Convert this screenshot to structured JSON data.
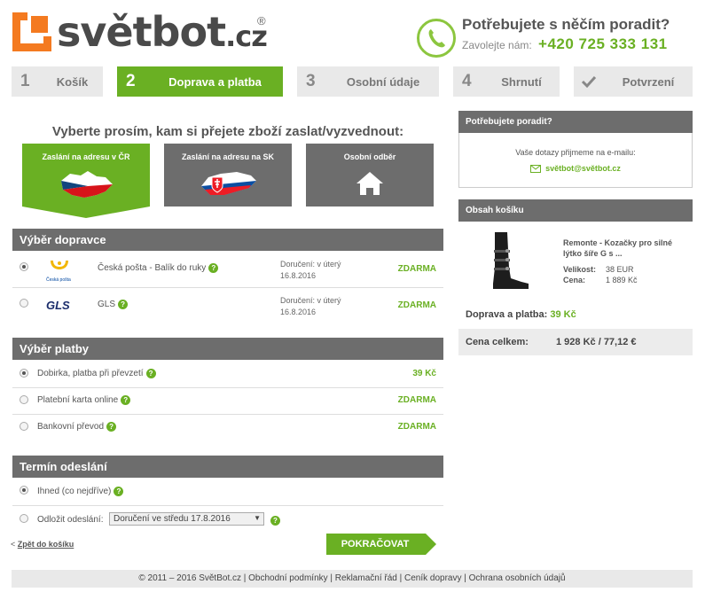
{
  "header": {
    "logo_main": "světbot",
    "logo_tld": ".cz",
    "logo_reg": "®",
    "help_title": "Potřebujete s něčím poradit?",
    "call_label": "Zavolejte nám:",
    "phone": "+420 725 333 131",
    "accent_color": "#6ab023",
    "logo_color": "#f47a20"
  },
  "steps": [
    {
      "num": "1",
      "label": "Košík"
    },
    {
      "num": "2",
      "label": "Doprava a platba"
    },
    {
      "num": "3",
      "label": "Osobní údaje"
    },
    {
      "num": "4",
      "label": "Shrnutí"
    },
    {
      "num": "check-icon",
      "label": "Potvrzení"
    }
  ],
  "destination": {
    "question": "Vyberte prosím, kam si přejete zboží zaslat/vyzvednout:",
    "options": [
      "Zaslání na adresu v ČR",
      "Zaslání na adresu na SK",
      "Osobní odběr"
    ]
  },
  "carriers": {
    "title": "Výběr dopravce",
    "items": [
      {
        "name": "Česká pošta - Balík do ruky",
        "logo_text": "Česká pošta",
        "delivery1": "Doručení: v úterý",
        "delivery2": "16.8.2016",
        "price": "ZDARMA",
        "selected": true
      },
      {
        "name": "GLS",
        "logo_text": "GLS",
        "delivery1": "Doručení: v úterý",
        "delivery2": "16.8.2016",
        "price": "ZDARMA",
        "selected": false
      }
    ]
  },
  "payment": {
    "title": "Výběr platby",
    "items": [
      {
        "name": "Dobirka, platba při převzetí",
        "price": "39 Kč",
        "selected": true
      },
      {
        "name": "Platební karta online",
        "price": "ZDARMA",
        "selected": false
      },
      {
        "name": "Bankovní převod",
        "price": "ZDARMA",
        "selected": false
      }
    ]
  },
  "dispatch": {
    "title": "Termín odeslání",
    "now_label": "Ihned (co nejdříve)",
    "later_label": "Odložit odeslání:",
    "later_value": "Doručení ve středu 17.8.2016"
  },
  "nav": {
    "back_prefix": "<",
    "back_label": "Zpět do košíku",
    "continue_label": "POKRAČOVAT"
  },
  "sidebar": {
    "help_title": "Potřebujete poradit?",
    "help_text": "Vaše dotazy přijmeme na e-mailu:",
    "email": "světbot@světbot.cz",
    "cart_title": "Obsah košíku",
    "product_name": "Remonte - Kozačky pro silné lýtko šíře G s ...",
    "size_label": "Velikost:",
    "size_value": "38 EUR",
    "price_label": "Cena:",
    "price_value": "1 889 Kč",
    "shipping_label": "Doprava a platba:",
    "shipping_value": "39 Kč",
    "total_label": "Cena celkem:",
    "total_value": "1 928 Kč / 77,12 €"
  },
  "footer": {
    "text": "© 2011 – 2016 SvětBot.cz | Obchodní podmínky | Reklamační řád | Ceník dopravy | Ochrana osobních údajů"
  }
}
